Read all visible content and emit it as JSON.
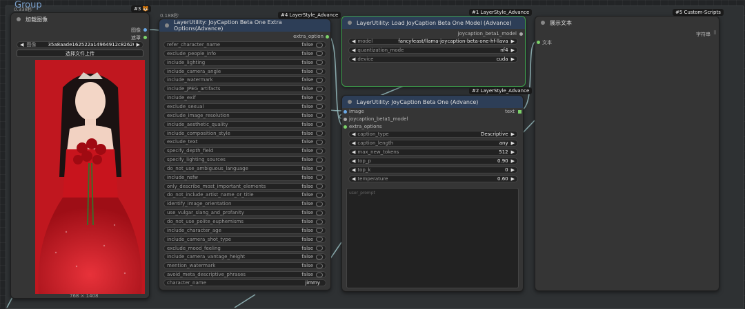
{
  "group": {
    "title": "Group"
  },
  "node3": {
    "badge": "#3 🐯",
    "timing": "0.338秒",
    "title": "加载图像",
    "out_image": "图像",
    "out_mask": "遮罩",
    "image_label": "图像",
    "image_value": "35a8aade162522a14964912c8262074527791...",
    "upload_label": "选择文件上传",
    "dims": "768 × 1408"
  },
  "node4": {
    "badge": "#4 LayerStyle_Advance",
    "timing": "0.188秒",
    "title": "LayerUtility: JoyCaption Beta One Extra Options(Advance)",
    "out_extra": "extra_option",
    "toggles": [
      {
        "label": "refer_character_name",
        "value": "false"
      },
      {
        "label": "exclude_people_info",
        "value": "false"
      },
      {
        "label": "include_lighting",
        "value": "false"
      },
      {
        "label": "include_camera_angle",
        "value": "false"
      },
      {
        "label": "include_watermark",
        "value": "false"
      },
      {
        "label": "include_JPEG_artifacts",
        "value": "false"
      },
      {
        "label": "include_exif",
        "value": "false"
      },
      {
        "label": "exclude_sexual",
        "value": "false"
      },
      {
        "label": "exclude_image_resolution",
        "value": "false"
      },
      {
        "label": "include_aesthetic_quality",
        "value": "false"
      },
      {
        "label": "include_composition_style",
        "value": "false"
      },
      {
        "label": "exclude_text",
        "value": "false"
      },
      {
        "label": "specify_depth_field",
        "value": "false"
      },
      {
        "label": "specify_lighting_sources",
        "value": "false"
      },
      {
        "label": "do_not_use_ambiguous_language",
        "value": "false"
      },
      {
        "label": "include_nsfw",
        "value": "false"
      },
      {
        "label": "only_describe_most_important_elements",
        "value": "false"
      },
      {
        "label": "do_not_include_artist_name_or_title",
        "value": "false"
      },
      {
        "label": "identify_image_orientation",
        "value": "false"
      },
      {
        "label": "use_vulgar_slang_and_profanity",
        "value": "false"
      },
      {
        "label": "do_not_use_polite_euphemisms",
        "value": "false"
      },
      {
        "label": "include_character_age",
        "value": "false"
      },
      {
        "label": "include_camera_shot_type",
        "value": "false"
      },
      {
        "label": "exclude_mood_feeling",
        "value": "false"
      },
      {
        "label": "include_camera_vantage_height",
        "value": "false"
      },
      {
        "label": "mention_watermark",
        "value": "false"
      },
      {
        "label": "avoid_meta_descriptive_phrases",
        "value": "false"
      }
    ],
    "character_name_label": "character_name",
    "character_name_value": "jimmy"
  },
  "node1": {
    "badge": "#1 LayerStyle_Advance",
    "title": "LayerUtility: Load JoyCaption Beta One Model (Advance)",
    "out_model": "joycaption_beta1_model",
    "combos": [
      {
        "label": "model",
        "value": "fancyfeast/llama-joycaption-beta-one-hf-llava"
      },
      {
        "label": "quantization_mode",
        "value": "nf4"
      },
      {
        "label": "device",
        "value": "cuda"
      }
    ]
  },
  "node2": {
    "badge": "#2 LayerStyle_Advance",
    "title": "LayerUtility: JoyCaption Beta One (Advance)",
    "in_image": "image",
    "in_model": "joycaption_beta1_model",
    "in_extra": "extra_options",
    "out_text": "text",
    "combos": [
      {
        "label": "caption_type",
        "value": "Descriptive"
      },
      {
        "label": "caption_length",
        "value": "any"
      },
      {
        "label": "max_new_tokens",
        "value": "512"
      },
      {
        "label": "top_p",
        "value": "0.90"
      },
      {
        "label": "top_k",
        "value": "0"
      },
      {
        "label": "temperature",
        "value": "0.60"
      }
    ],
    "prompt_placeholder": "user_prompt"
  },
  "node5": {
    "badge": "#5 Custom-Scripts",
    "title": "展示文本",
    "in_text": "文本",
    "out_string": "字符串"
  },
  "colors": {
    "header_blue": "#2d3e57",
    "green_outline": "#3fa34d",
    "link": "#9fc7c9"
  }
}
